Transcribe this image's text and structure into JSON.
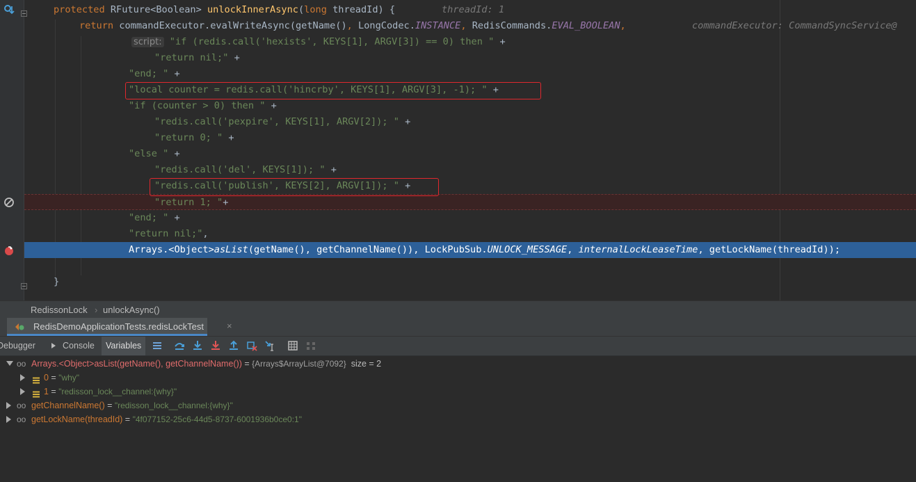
{
  "editor": {
    "inlay": {
      "thread_id": "threadId: 1",
      "command_executor": "commandExecutor: CommandSyncService@",
      "script_param": "script:"
    },
    "lines": {
      "l1": {
        "t1": "protected",
        "t2": " RFuture<Boolean> ",
        "t3": "unlockInnerAsync",
        "t4": "(",
        "t5": "long",
        "t6": " threadId) {"
      },
      "l2": {
        "t1": "return",
        "t2": " commandExecutor.evalWriteAsync(getName()",
        "t3": ", ",
        "t4": "LongCodec.",
        "t5": "INSTANCE",
        "t6": ", ",
        "t7": "RedisCommands.",
        "t8": "EVAL_BOOLEAN",
        "t9": ","
      },
      "l3": {
        "s": "\"if (redis.call('hexists', KEYS[1], ARGV[3]) == 0) then \"",
        "op": " +"
      },
      "l4": {
        "s": "\"return nil;\"",
        "op": " +"
      },
      "l5": {
        "s": "\"end; \"",
        "op": " +"
      },
      "l6": {
        "s": "\"local counter = redis.call('hincrby', KEYS[1], ARGV[3], -1); \"",
        "op": " +"
      },
      "l7": {
        "s": "\"if (counter > 0) then \"",
        "op": " +"
      },
      "l8": {
        "s": "\"redis.call('pexpire', KEYS[1], ARGV[2]); \"",
        "op": " +"
      },
      "l9": {
        "s": "\"return 0; \"",
        "op": " +"
      },
      "l10": {
        "s": "\"else \"",
        "op": " +"
      },
      "l11": {
        "s": "\"redis.call('del', KEYS[1]); \"",
        "op": " +"
      },
      "l12": {
        "s": "\"redis.call('publish', KEYS[2], ARGV[1]); \"",
        "op": " +"
      },
      "l13": {
        "s": "\"return 1; \"",
        "op": "+"
      },
      "l14": {
        "s": "\"end; \"",
        "op": " +"
      },
      "l15": {
        "s": "\"return nil;\"",
        "op": ","
      },
      "l16": {
        "t1": "Arrays.<Object>",
        "t2": "asList",
        "t3": "(getName(), getChannelName()), LockPubSub.",
        "t4": "UNLOCK_MESSAGE",
        "t5": ", ",
        "t6": "internalLockLeaseTime",
        "t7": ", getLockName(threadId));"
      },
      "l18": {
        "t1": "}"
      }
    }
  },
  "breadcrumb": {
    "class": "RedissonLock",
    "method": "unlockAsync()"
  },
  "debug": {
    "run_tab": "RedisDemoApplicationTests.redisLockTest",
    "tabs": {
      "debugger": "Debugger",
      "console": "Console",
      "variables": "Variables"
    },
    "toolbar_icons": [
      "frames-menu-icon",
      "step-over-icon",
      "step-into-icon",
      "force-step-into-icon",
      "step-out-icon",
      "drop-frame-icon",
      "run-to-cursor-icon",
      "evaluate-expression-icon",
      "trace-icon"
    ],
    "variables": {
      "v1": {
        "name": "Arrays.<Object>asList(getName(), getChannelName())",
        "eq": " = ",
        "value": "{Arrays$ArrayList@7092}",
        "extra": "  size = 2"
      },
      "v2": {
        "name": "0",
        "eq": " = ",
        "value": "\"why\""
      },
      "v3": {
        "name": "1",
        "eq": " = ",
        "value": "\"redisson_lock__channel:{why}\""
      },
      "v4": {
        "name": "getChannelName()",
        "eq": " = ",
        "value": "\"redisson_lock__channel:{why}\""
      },
      "v5": {
        "name": "getLockName(threadId)",
        "eq": " = ",
        "value": "\"4f077152-25c6-44d5-8737-6001936b0ce0:1\""
      }
    }
  },
  "colors": {
    "editor_bg": "#2b2b2b",
    "keyword": "#cc7832",
    "string": "#6a8759",
    "method": "#ffc66d",
    "static_field": "#9876aa",
    "execution_line": "#2d6099",
    "highlight_box": "#e0282e"
  }
}
